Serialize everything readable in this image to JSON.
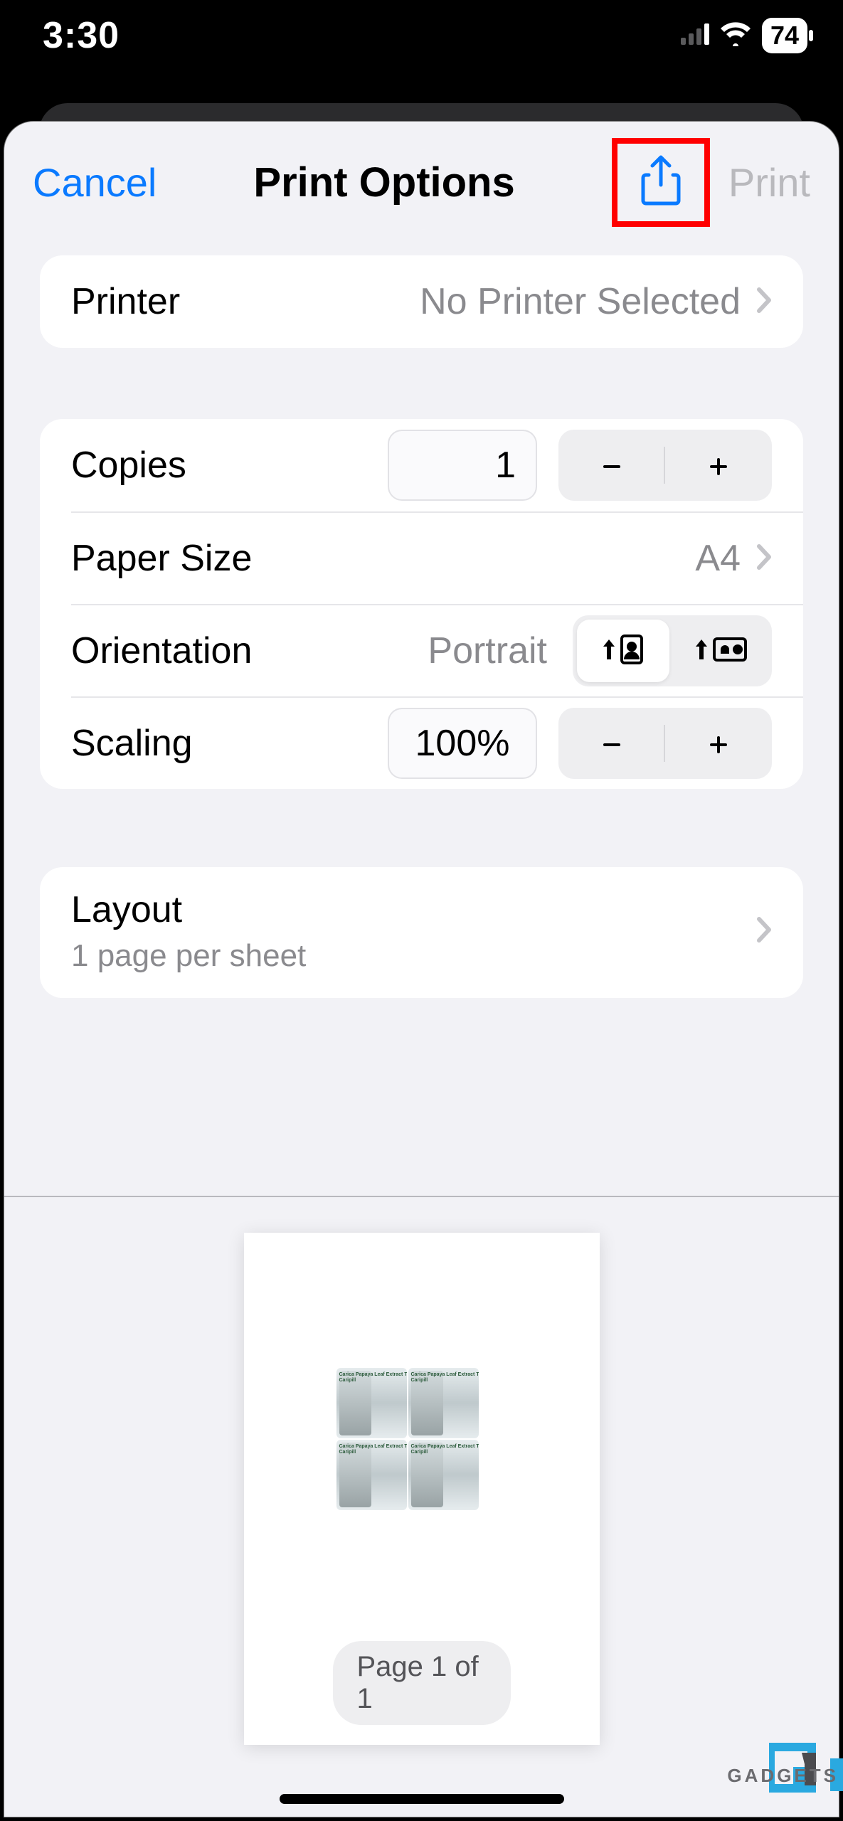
{
  "status": {
    "time": "3:30",
    "battery": "74"
  },
  "nav": {
    "cancel": "Cancel",
    "title": "Print Options",
    "print": "Print"
  },
  "printer": {
    "label": "Printer",
    "value": "No Printer Selected"
  },
  "copies": {
    "label": "Copies",
    "value": "1"
  },
  "paper": {
    "label": "Paper Size",
    "value": "A4"
  },
  "orientation": {
    "label": "Orientation",
    "value": "Portrait"
  },
  "scaling": {
    "label": "Scaling",
    "value": "100%"
  },
  "layout": {
    "label": "Layout",
    "sub": "1 page per sheet"
  },
  "preview": {
    "page_label": "Page 1 of 1"
  },
  "watermark": {
    "text": "GADGETS"
  }
}
